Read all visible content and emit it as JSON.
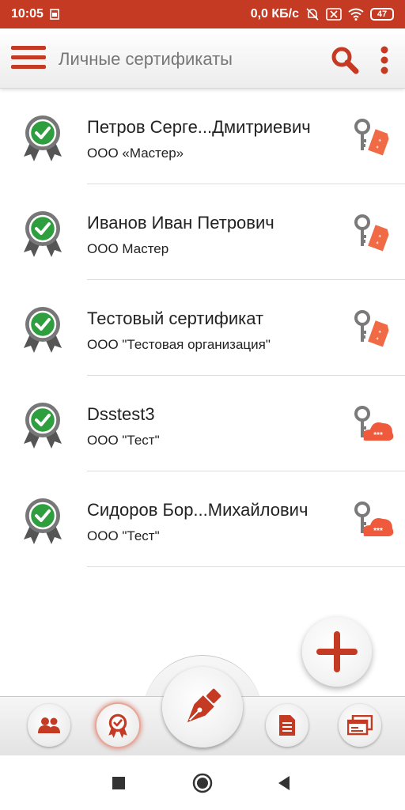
{
  "status_bar": {
    "time": "10:05",
    "network_speed": "0,0 КБ/с",
    "battery": "47"
  },
  "app_bar": {
    "title": "Личные сертификаты",
    "menu_icon": "hamburger-menu-icon",
    "search_icon": "search-icon",
    "more_icon": "more-vertical-icon"
  },
  "certificates": [
    {
      "name": "Петров Серге...Дмитриевич",
      "org": "ООО «Мастер»",
      "storage": "token"
    },
    {
      "name": "Иванов Иван Петрович",
      "org": "ООО Мастер",
      "storage": "token"
    },
    {
      "name": "Тестовый сертификат",
      "org": "ООО \"Тестовая организация\"",
      "storage": "token"
    },
    {
      "name": "Dsstest3",
      "org": "ООО \"Тест\"",
      "storage": "cloud"
    },
    {
      "name": "Сидоров Бор...Михайлович",
      "org": "ООО \"Тест\"",
      "storage": "cloud"
    }
  ],
  "colors": {
    "accent": "#c43a23",
    "badge_green": "#2e9e3e",
    "badge_gray": "#555555",
    "key_gray": "#7a7a7a",
    "tag_orange": "#ef6a45"
  },
  "bottom_nav": {
    "items": [
      "contacts-icon",
      "certificates-icon",
      "sign-pen-icon",
      "documents-icon",
      "windows-icon"
    ],
    "active": "certificates-icon"
  }
}
